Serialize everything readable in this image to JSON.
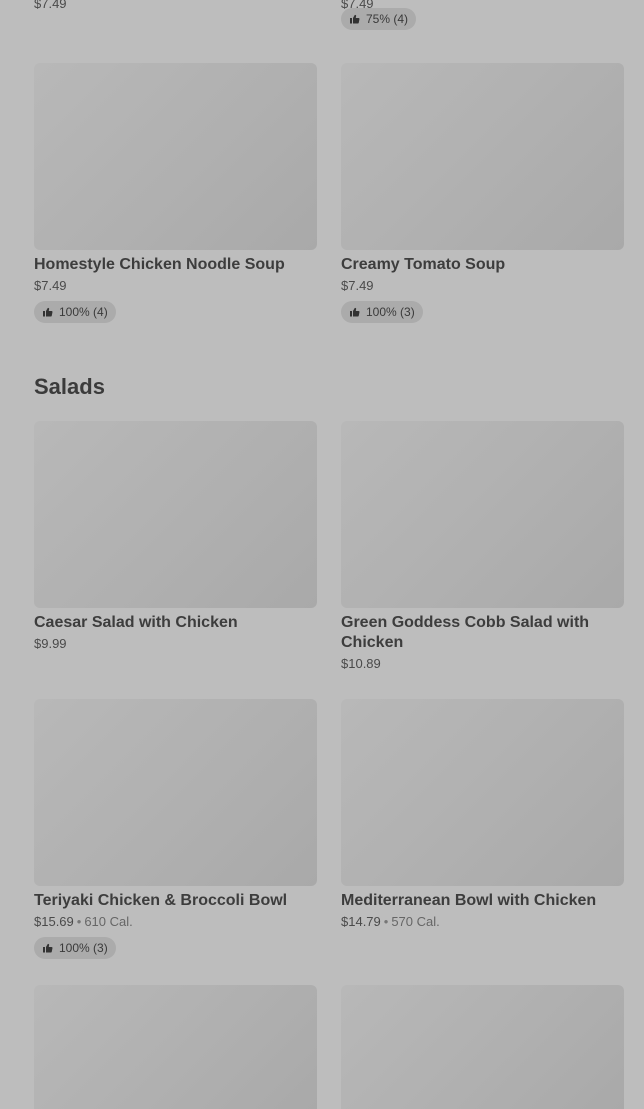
{
  "top_row": {
    "left_price": "$7.49",
    "right_price": "$7.49",
    "right_rating": "75% (4)"
  },
  "soups": [
    {
      "name": "Homestyle Chicken Noodle Soup",
      "price": "$7.49",
      "rating": "100% (4)"
    },
    {
      "name": "Creamy Tomato Soup",
      "price": "$7.49",
      "rating": "100% (3)"
    }
  ],
  "salads_section": {
    "title": "Salads",
    "items": [
      {
        "name": "Caesar Salad with Chicken",
        "price": "$9.99"
      },
      {
        "name": "Green Goddess Cobb Salad with Chicken",
        "price": "$10.89"
      },
      {
        "name": "Teriyaki Chicken & Broccoli Bowl",
        "price": "$15.69",
        "calories": "610 Cal.",
        "rating": "100% (3)"
      },
      {
        "name": "Mediterranean Bowl with Chicken",
        "price": "$14.79",
        "calories": "570 Cal."
      }
    ]
  },
  "separator": "•",
  "icons": {
    "rating": "thumbs-up-icon"
  },
  "colors": {
    "overlay_bg": "#bdbdbd",
    "image_placeholder": "#b0b0b0",
    "badge_bg": "#ababab"
  }
}
